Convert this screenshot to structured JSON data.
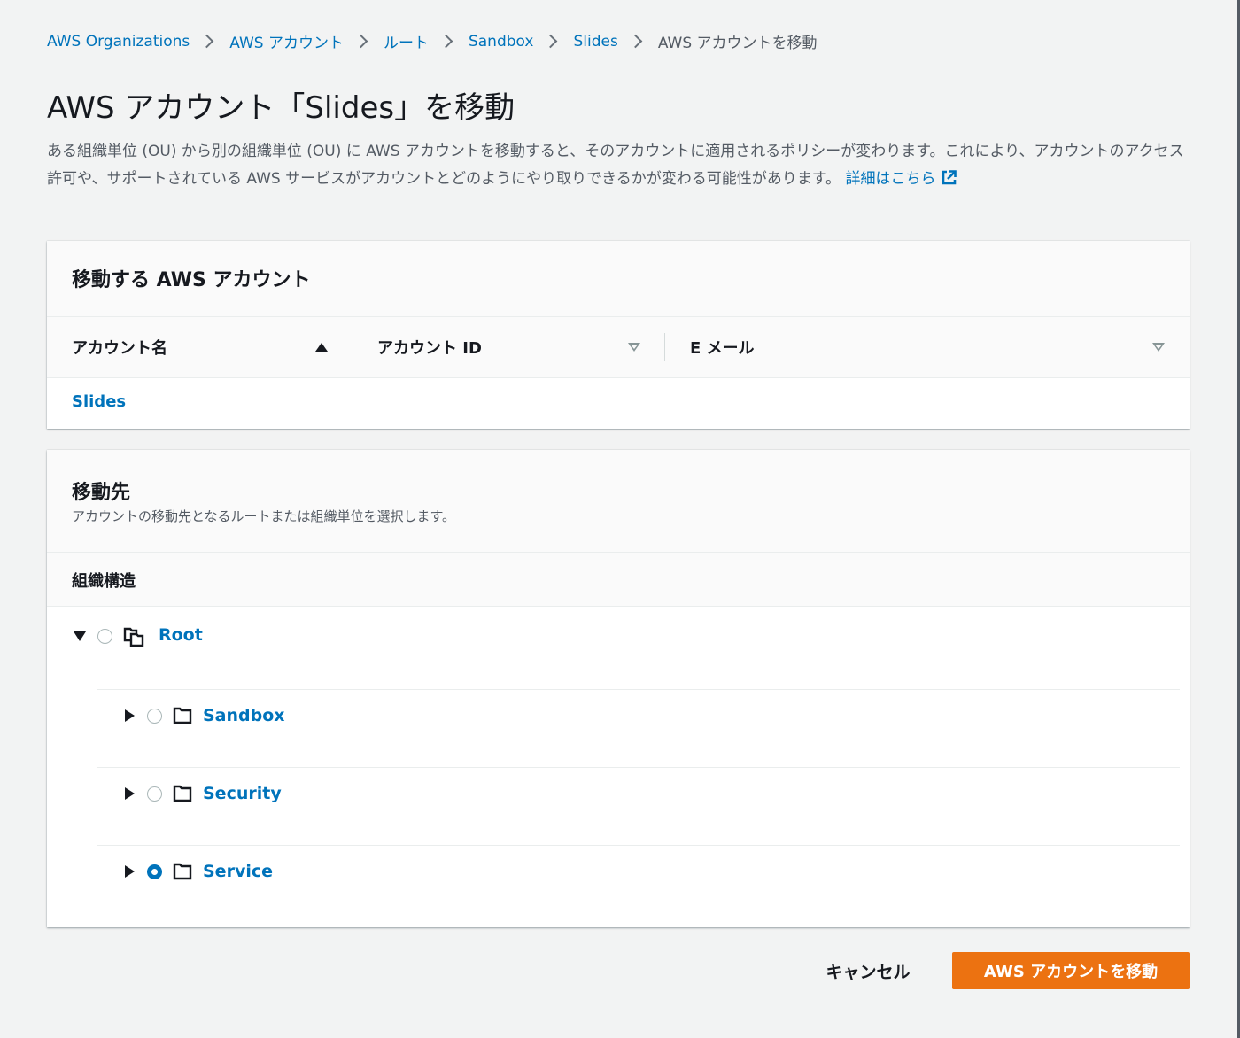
{
  "breadcrumb": {
    "items": [
      "AWS Organizations",
      "AWS アカウント",
      "ルート",
      "Sandbox",
      "Slides"
    ],
    "current": "AWS アカウントを移動"
  },
  "page": {
    "title": "AWS アカウント「Slides」を移動",
    "description": "ある組織単位 (OU) から別の組織単位 (OU) に AWS アカウントを移動すると、そのアカウントに適用されるポリシーが変わります。これにより、アカウントのアクセス許可や、サポートされている AWS サービスがアカウントとどのようにやり取りできるかが変わる可能性があります。",
    "learn_more": "詳細はこちら"
  },
  "accounts_panel": {
    "title": "移動する AWS アカウント",
    "columns": [
      "アカウント名",
      "アカウント ID",
      "E メール"
    ],
    "rows": [
      {
        "name": "Slides"
      }
    ]
  },
  "destination_panel": {
    "title": "移動先",
    "subtitle": "アカウントの移動先となるルートまたは組織単位を選択します。",
    "tree_header": "組織構造",
    "tree": {
      "root": {
        "label": "Root",
        "expanded": true,
        "selected": false,
        "icon": "root-icon"
      },
      "children": [
        {
          "label": "Sandbox",
          "expanded": false,
          "selected": false,
          "icon": "folder-icon"
        },
        {
          "label": "Security",
          "expanded": false,
          "selected": false,
          "icon": "folder-icon"
        },
        {
          "label": "Service",
          "expanded": false,
          "selected": true,
          "icon": "folder-icon"
        }
      ]
    }
  },
  "actions": {
    "cancel": "キャンセル",
    "submit": "AWS アカウントを移動"
  },
  "colors": {
    "link": "#0073bb",
    "primary_button": "#ec7211",
    "background": "#f2f3f3"
  }
}
